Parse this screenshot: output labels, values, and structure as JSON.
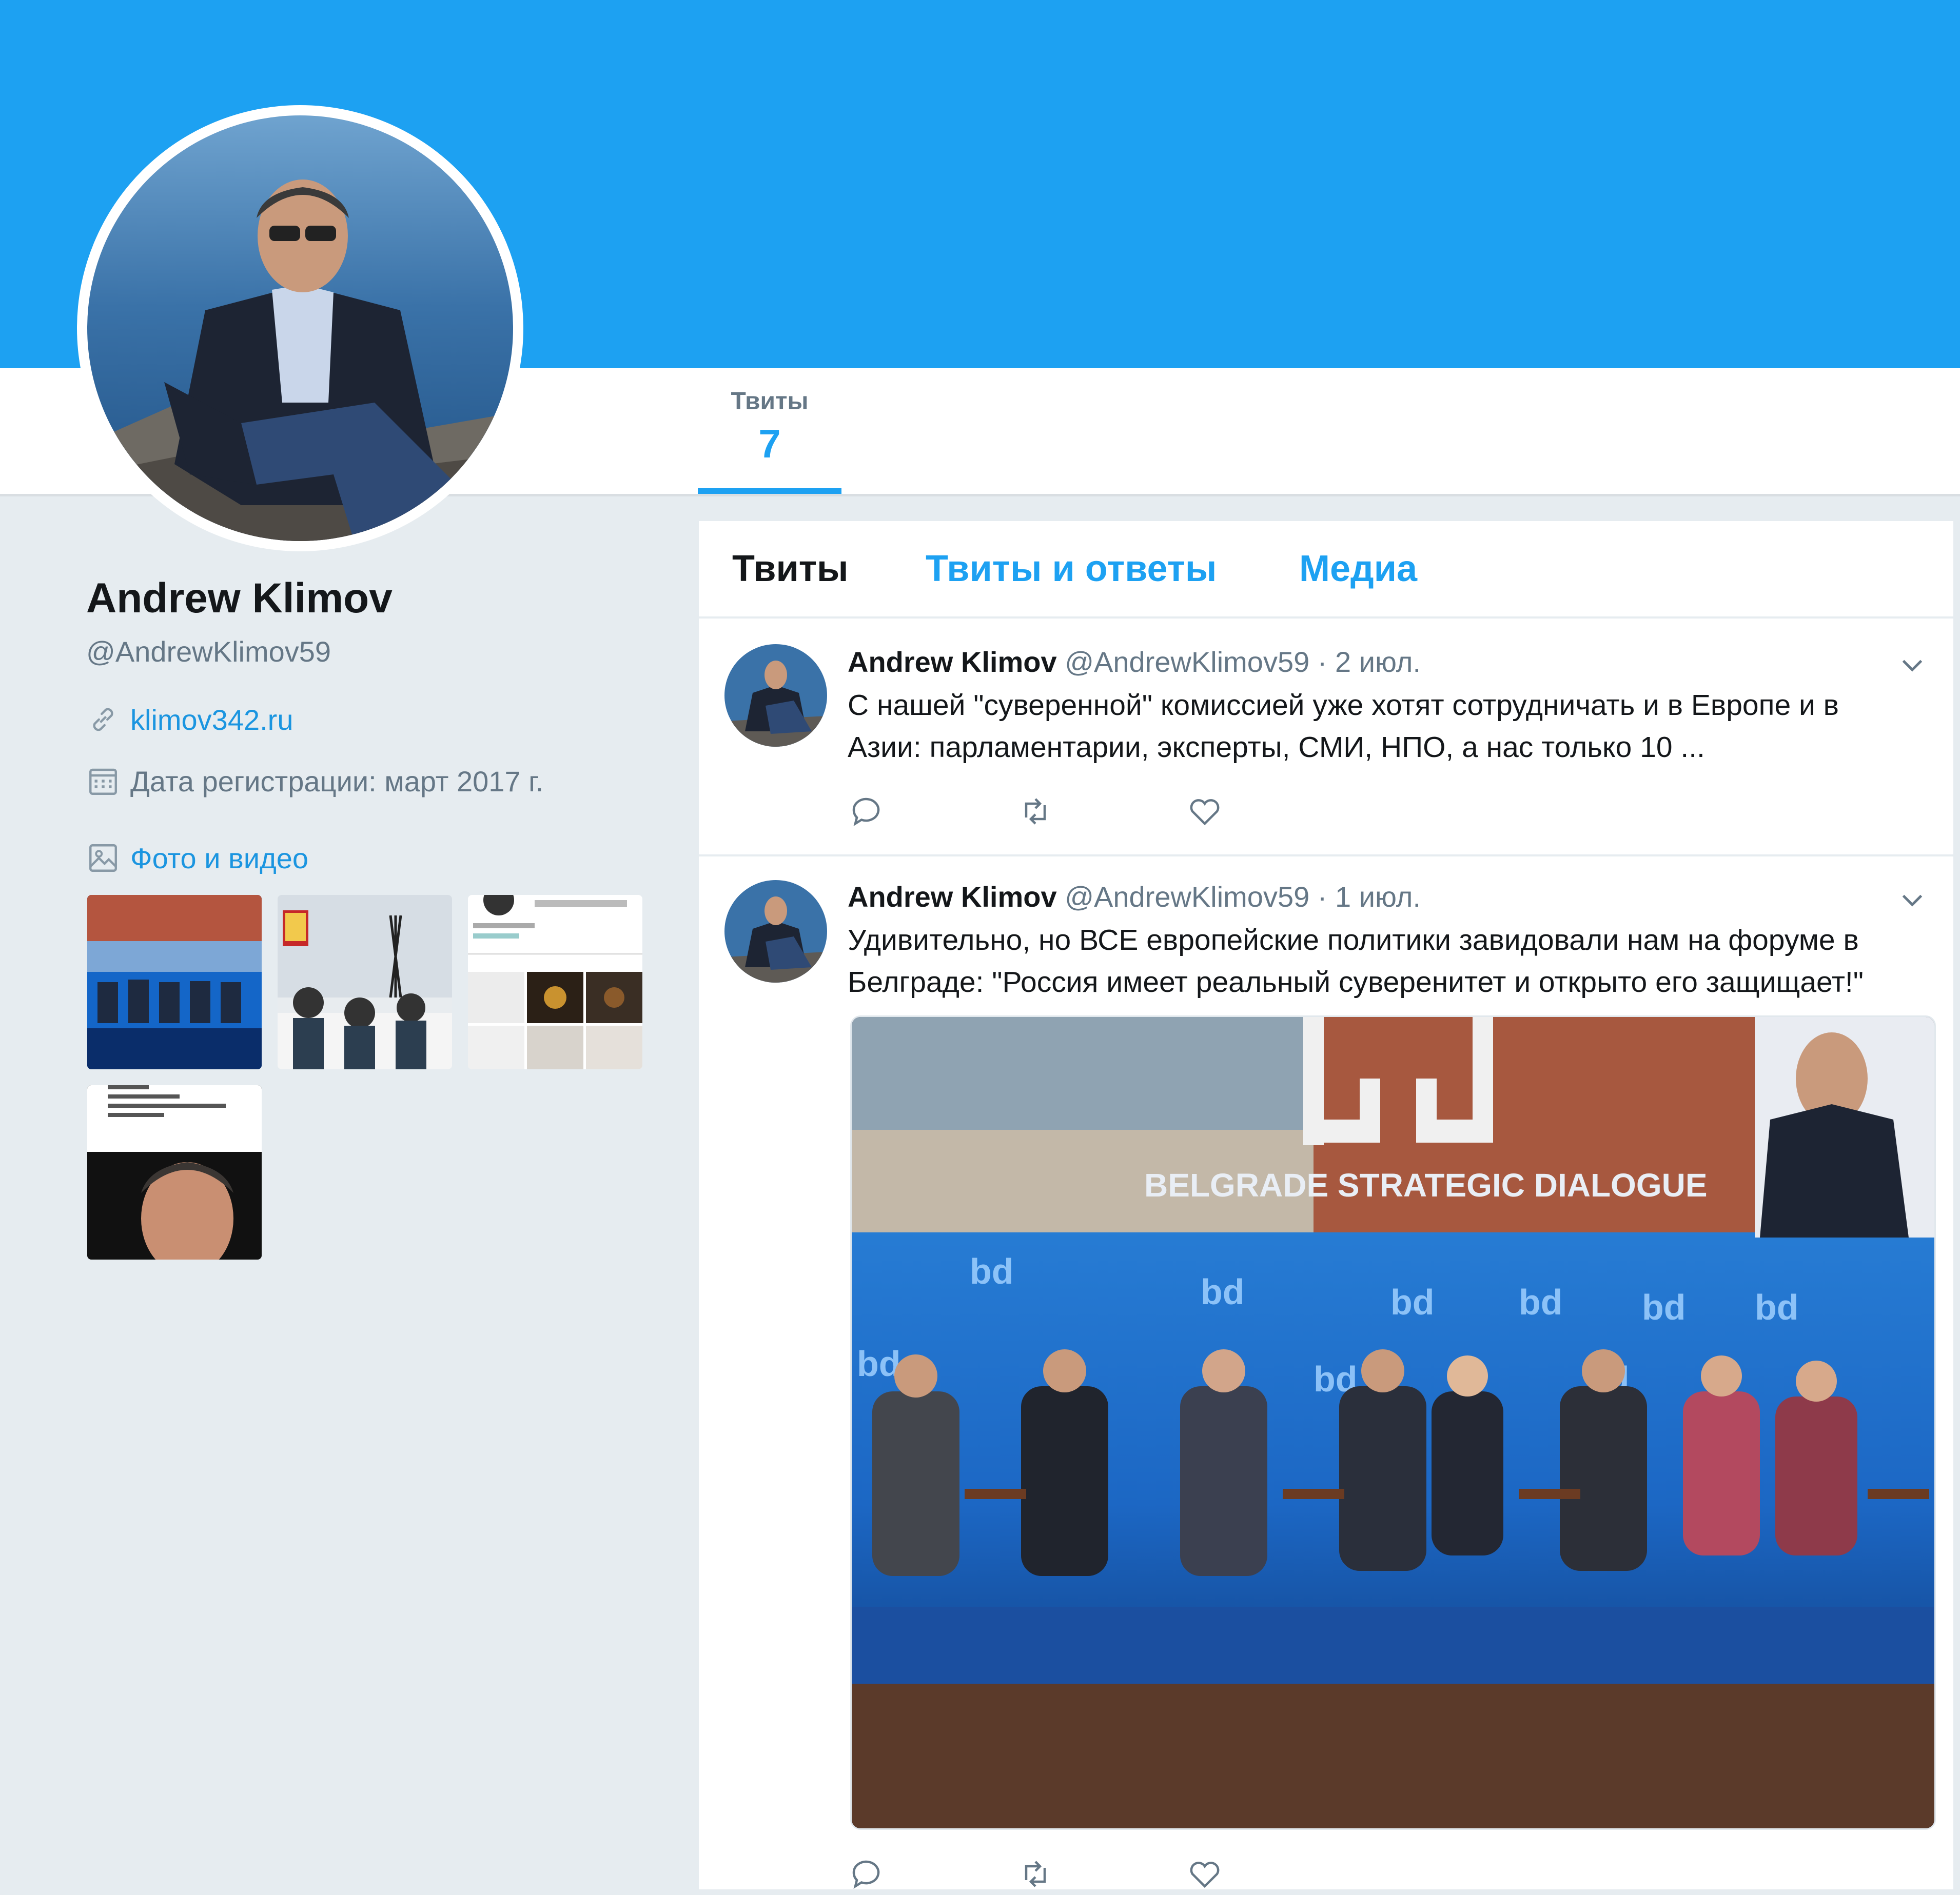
{
  "colors": {
    "accent": "#1da1f2",
    "background": "#e6ecf0",
    "text": "#14171a",
    "muted": "#657786"
  },
  "nav": {
    "stats": [
      {
        "label": "Твиты",
        "value": "7"
      }
    ]
  },
  "profile": {
    "name": "Andrew Klimov",
    "handle": "@AndrewKlimov59",
    "website": "klimov342.ru",
    "joined": "Дата регистрации: март 2017 г.",
    "photos_label": "Фото и видео",
    "icons": {
      "link": "link-icon",
      "calendar": "calendar-icon",
      "photo": "photo-icon"
    }
  },
  "timeline": {
    "tabs": [
      "Твиты",
      "Твиты и ответы",
      "Медиа"
    ],
    "tweets": [
      {
        "name": "Andrew Klimov",
        "handle": "@AndrewKlimov59",
        "separator": "·",
        "date": "2 июл.",
        "text": "С нашей \"суверенной\" комиссией уже хотят сотрудничать и в Европе и в Азии: парламентарии, эксперты, СМИ, НПО, а нас только 10 ..."
      },
      {
        "name": "Andrew Klimov",
        "handle": "@AndrewKlimov59",
        "separator": "·",
        "date": "1 июл.",
        "text": "Удивительно, но ВСЕ европейские политики завидовали нам на форуме в Белграде: \"Россия имеет реальный суверенитет и открыто его защищает!\"",
        "image_caption": "BELGRADE STRATEGIC DIALOGUE",
        "image_logo": "bd"
      }
    ]
  }
}
